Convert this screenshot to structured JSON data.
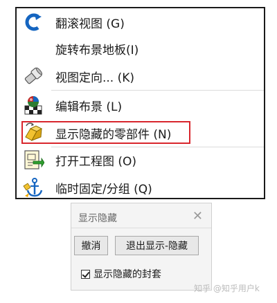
{
  "menu": {
    "items": [
      {
        "label": "翻滚视图 (G)",
        "icon": "rotate-view-icon"
      },
      {
        "label": "旋转布景地板(I)",
        "icon": "none"
      },
      {
        "label": "视图定向... (K)",
        "icon": "view-orientation-icon"
      },
      {
        "label": "编辑布景 (L)",
        "icon": "edit-scene-icon"
      },
      {
        "label": "显示隐藏的零部件 (N)",
        "icon": "show-hidden-components-icon"
      },
      {
        "label": "打开工程图 (O)",
        "icon": "open-drawing-icon"
      },
      {
        "label": "临时固定/分组 (Q)",
        "icon": "temp-fix-group-icon"
      }
    ]
  },
  "dialog": {
    "title": "显示隐藏",
    "cancel_label": "撤消",
    "exit_label": "退出显示-隐藏",
    "checkbox_label": "显示隐藏的封套",
    "checkbox_checked": true
  },
  "watermark": "知乎 @知乎用户k",
  "colors": {
    "highlight": "#d8252c",
    "menu_border": "#1a1a1a",
    "dialog_bg": "#f4f4f4"
  }
}
